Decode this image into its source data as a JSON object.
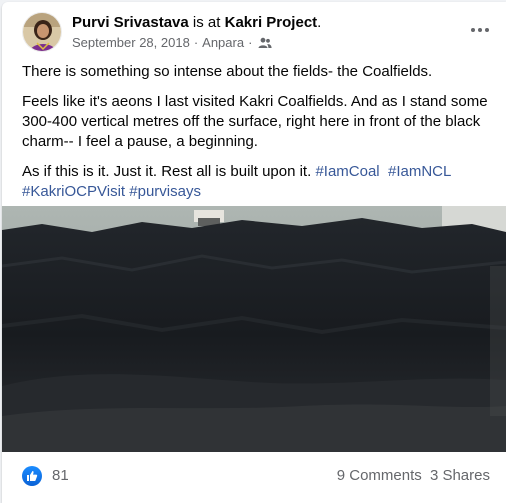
{
  "post": {
    "author": "Purvi Srivastava",
    "connector": " is at ",
    "place": "Kakri Project",
    "place_suffix": ".",
    "date": "September 28, 2018",
    "separator": "·",
    "location": "Anpara",
    "separator2": "·",
    "privacy_icon": "friends-icon",
    "more_icon": "more-options-icon",
    "paragraph1": "There is something so intense about the fields- the Coalfields.",
    "paragraph2": "Feels like it's aeons I last visited Kakri Coalfields. And as I stand some 300-400 vertical metres off the surface, right here in front of the black charm-- I feel a pause, a beginning.",
    "paragraph3_text": "As if this is it. Just it. Rest all is built upon it. ",
    "hashtags": [
      "#IamCoal",
      "#IamNCL",
      "#KakriOCPVisit",
      "#purvisays"
    ],
    "photo_alt": "coal mine wall photo"
  },
  "footer": {
    "like_icon": "like-icon",
    "reaction_count": "81",
    "comments": "9 Comments",
    "shares": "3 Shares"
  },
  "colors": {
    "link": "#385898",
    "secondary_text": "#65676b",
    "like_blue": "#1877f2"
  }
}
